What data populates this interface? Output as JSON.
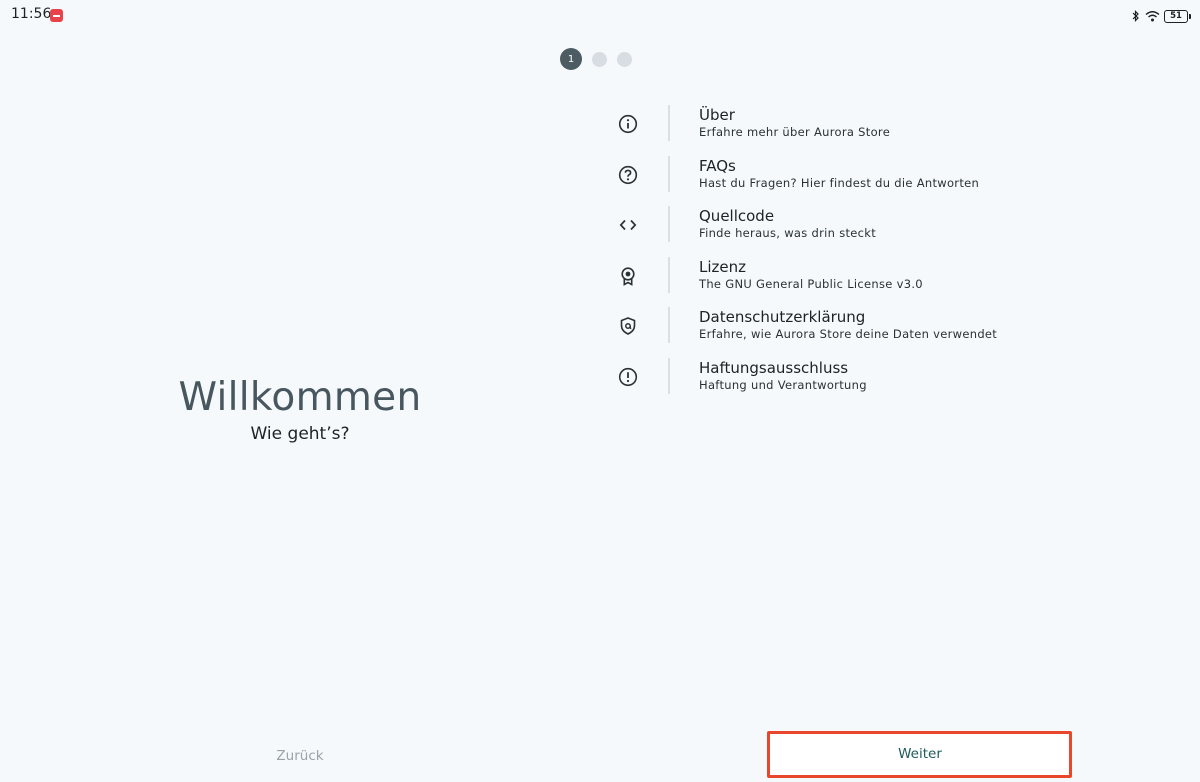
{
  "status_bar": {
    "time": "11:56",
    "battery": "51"
  },
  "stepper": {
    "current": "1",
    "total_steps": 3
  },
  "welcome": {
    "title": "Willkommen",
    "subtitle": "Wie geht’s?"
  },
  "links": [
    {
      "icon": "info-icon",
      "title": "Über",
      "subtitle": "Erfahre mehr über Aurora Store"
    },
    {
      "icon": "help-icon",
      "title": "FAQs",
      "subtitle": "Hast du Fragen? Hier findest du die Antworten"
    },
    {
      "icon": "code-icon",
      "title": "Quellcode",
      "subtitle": "Finde heraus, was drin steckt"
    },
    {
      "icon": "license-icon",
      "title": "Lizenz",
      "subtitle": "The GNU General Public License v3.0"
    },
    {
      "icon": "privacy-icon",
      "title": "Datenschutzerklärung",
      "subtitle": "Erfahre, wie Aurora Store deine Daten verwendet"
    },
    {
      "icon": "disclaimer-icon",
      "title": "Haftungsausschluss",
      "subtitle": "Haftung und Verantwortung"
    }
  ],
  "footer": {
    "back_label": "Zurück",
    "next_label": "Weiter"
  },
  "colors": {
    "background": "#f5f9fc",
    "accent": "#4d5b63",
    "next_text": "#205c5e",
    "highlight_border": "#e8472b"
  }
}
